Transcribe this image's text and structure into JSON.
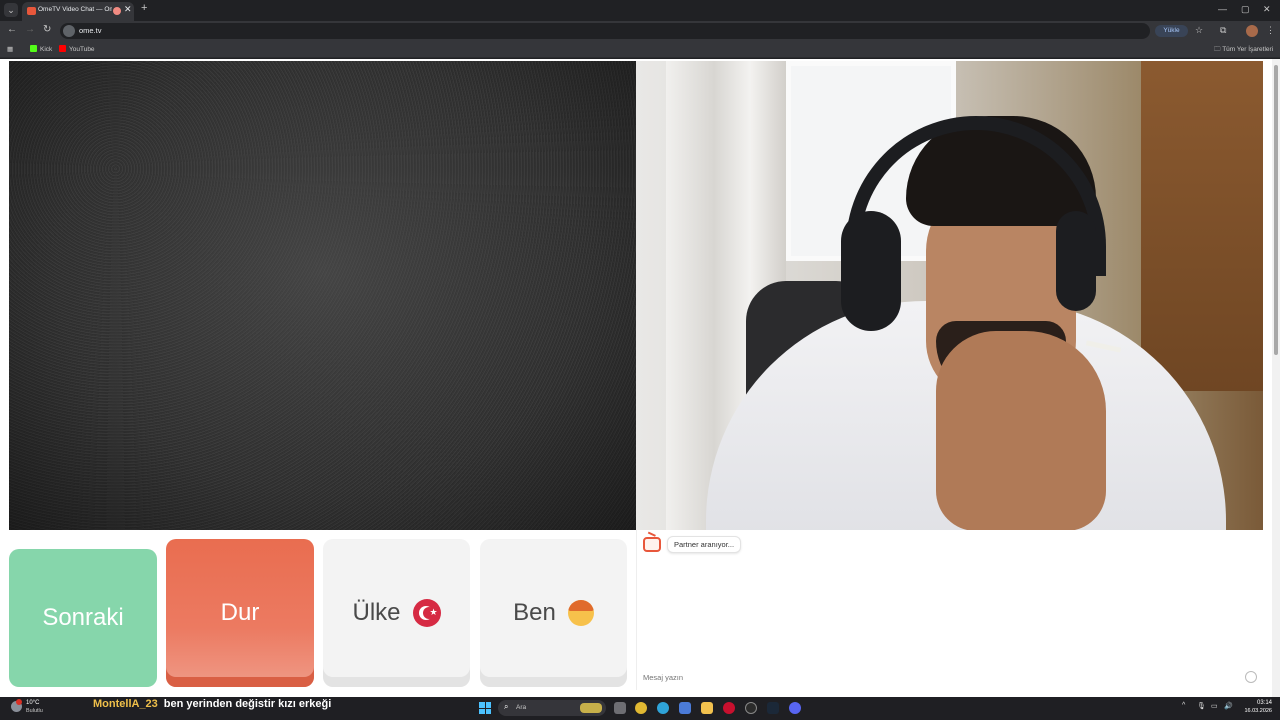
{
  "browser": {
    "tab_title": "OmeTV Video Chat — Ome",
    "tab_close": "✕",
    "new_tab": "+",
    "url": "ome.tv",
    "install_label": "Yükle",
    "bookmarks": [
      {
        "label": "Kick",
        "color": "#53fc18"
      },
      {
        "label": "YouTube",
        "color": "#ff0000"
      }
    ],
    "all_bookmarks": "Tüm Yer İşaretleri",
    "window_controls": {
      "minimize": "—",
      "maximize": "▢",
      "close": "✕"
    }
  },
  "controls": {
    "next_label": "Sonraki",
    "stop_label": "Dur",
    "country_label": "Ülke",
    "country_flag": "turkey-flag-icon",
    "me_label": "Ben",
    "me_icon": "boy-face-icon"
  },
  "chat": {
    "status_message": "Partner aranıyor...",
    "input_placeholder": "Mesaj yazın"
  },
  "taskbar": {
    "weather_temp": "10°C",
    "weather_cond": "Bulutlu",
    "overlay_user": "MontellA_23",
    "overlay_message": "ben yerinden değistir kızı erkeği",
    "search_placeholder": "Ara",
    "time": "03:14",
    "date": "16.03.2026"
  },
  "colors": {
    "next": "#86d6ab",
    "stop": "#e96d50",
    "neutral": "#f3f3f3",
    "accent": "#e8573b"
  }
}
